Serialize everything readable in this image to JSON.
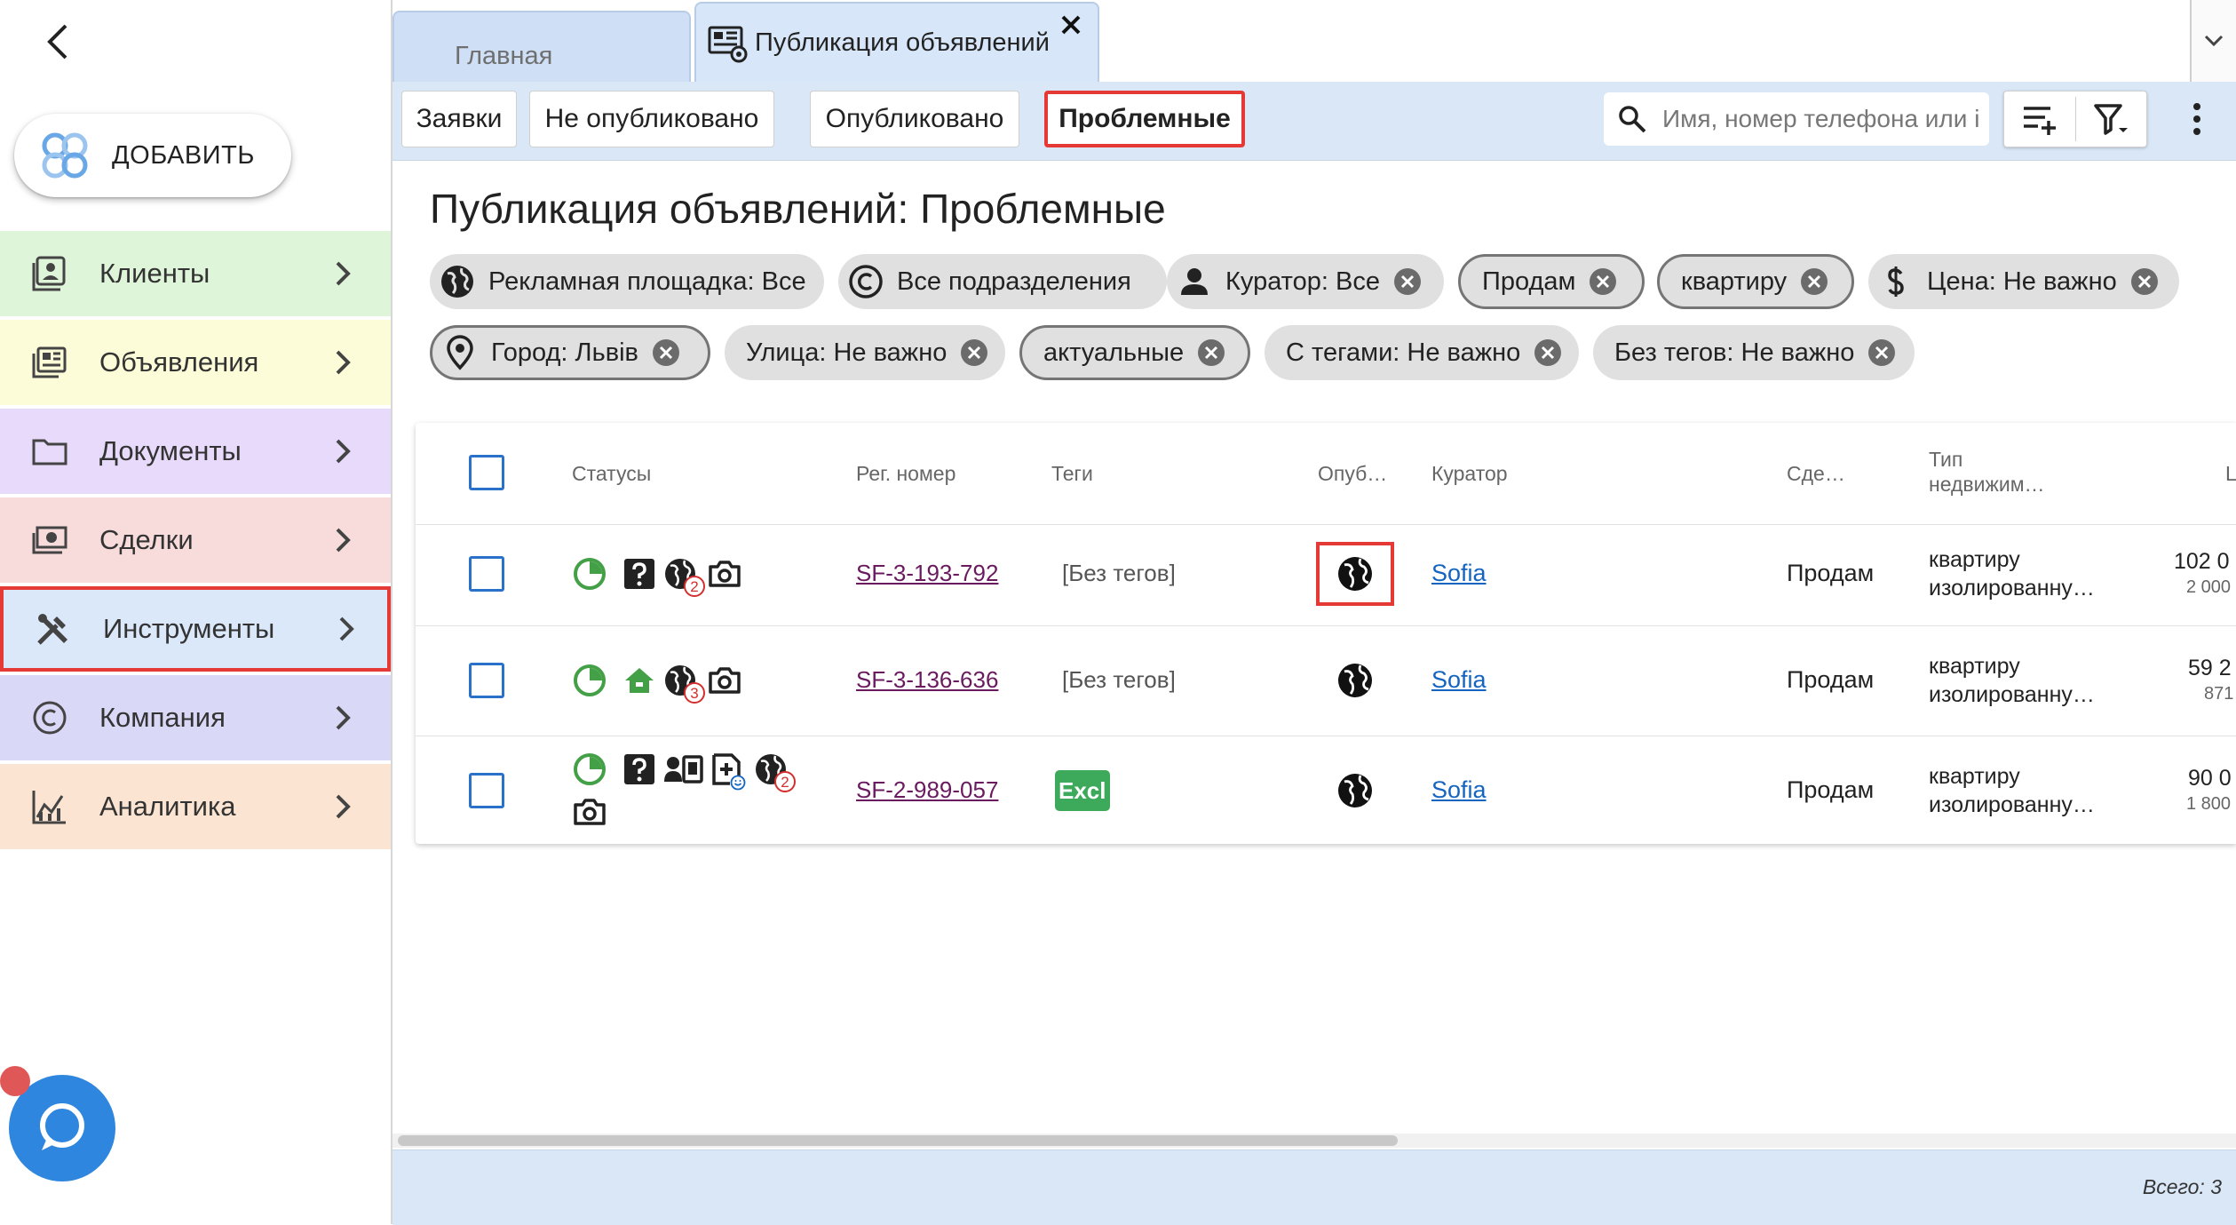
{
  "sidebar": {
    "add_label": "ДОБАВИТЬ",
    "items": [
      {
        "label": "Клиенты",
        "bg": "#dff5d9",
        "icon": "contacts-icon"
      },
      {
        "label": "Объявления",
        "bg": "#fdfcd9",
        "icon": "listing-icon"
      },
      {
        "label": "Документы",
        "bg": "#e7dafa",
        "icon": "folder-icon"
      },
      {
        "label": "Сделки",
        "bg": "#f8dcdc",
        "icon": "money-icon"
      },
      {
        "label": "Инструменты",
        "bg": "#dbe8fa",
        "icon": "tools-icon"
      },
      {
        "label": "Компания",
        "bg": "#dad8f7",
        "icon": "copyright-icon"
      },
      {
        "label": "Аналитика",
        "bg": "#fbe5d2",
        "icon": "analytics-icon"
      }
    ]
  },
  "tabs": {
    "home": "Главная",
    "publication": "Публикация объявлений"
  },
  "toolbar": {
    "filters": [
      "Заявки",
      "Не опубликовано",
      "Опубликовано",
      "Проблемные"
    ],
    "active_filter": "Проблемные",
    "search_placeholder": "Имя, номер телефона или i"
  },
  "main": {
    "title": "Публикация объявлений: Проблемные",
    "chips": [
      {
        "label": "Рекламная площадка: Все",
        "icon": "globe-icon",
        "removable": false
      },
      {
        "label": "Все подразделения",
        "icon": "copyright-icon",
        "removable": false
      },
      {
        "label": "Куратор: Все",
        "icon": "person-icon",
        "removable": true
      },
      {
        "label": "Продам",
        "icon": "",
        "removable": true
      },
      {
        "label": "квартиру",
        "icon": "",
        "removable": true
      },
      {
        "label": "Цена: Не важно",
        "icon": "dollar-icon",
        "removable": true
      },
      {
        "label": "Город: Львів",
        "icon": "location-pin-icon",
        "removable": true
      },
      {
        "label": "Улица: Не важно",
        "icon": "",
        "removable": true
      },
      {
        "label": "актуальные",
        "icon": "",
        "removable": true
      },
      {
        "label": "С тегами: Не важно",
        "icon": "",
        "removable": true
      },
      {
        "label": "Без тегов: Не важно",
        "icon": "",
        "removable": true
      }
    ]
  },
  "table": {
    "headers": {
      "statuses": "Статусы",
      "reg": "Рег. номер",
      "tags": "Теги",
      "published": "Опуб…",
      "curator": "Куратор",
      "deal": "Сде…",
      "type_line1": "Тип",
      "type_line2": "недвижим…",
      "price": "Ц"
    },
    "rows": [
      {
        "reg": "SF-3-193-792",
        "tags": "[Без тегов]",
        "curator": "Sofia",
        "deal": "Продам",
        "type_line1": "квартиру",
        "type_line2": "изолированну…",
        "price": "102 0",
        "price_sub": "2 000",
        "status_icons": [
          "pie-clock-icon",
          "question-icon",
          "globe-icon",
          "camera-icon"
        ],
        "globe_badge": "2"
      },
      {
        "reg": "SF-3-136-636",
        "tags": "[Без тегов]",
        "curator": "Sofia",
        "deal": "Продам",
        "type_line1": "квартиру",
        "type_line2": "изолированну…",
        "price": "59 2",
        "price_sub": "871",
        "status_icons": [
          "pie-clock-icon",
          "house-icon",
          "globe-icon",
          "camera-icon"
        ],
        "globe_badge": "3"
      },
      {
        "reg": "SF-2-989-057",
        "tag_label": "Excl",
        "curator": "Sofia",
        "deal": "Продам",
        "type_line1": "квартиру",
        "type_line2": "изолированну…",
        "price": "90 0",
        "price_sub": "1 800",
        "status_icons": [
          "pie-clock-icon",
          "question-icon",
          "id-card-icon",
          "doc-add-icon",
          "globe-icon",
          "camera-icon"
        ],
        "globe_badge": "2"
      }
    ]
  },
  "footer": {
    "total": "Всего: 3"
  },
  "colors": {
    "accent_blue": "#2a71c9",
    "highlight_red": "#e53935",
    "status_green": "#43a047",
    "toolbar_bg": "#d9e7f7"
  }
}
